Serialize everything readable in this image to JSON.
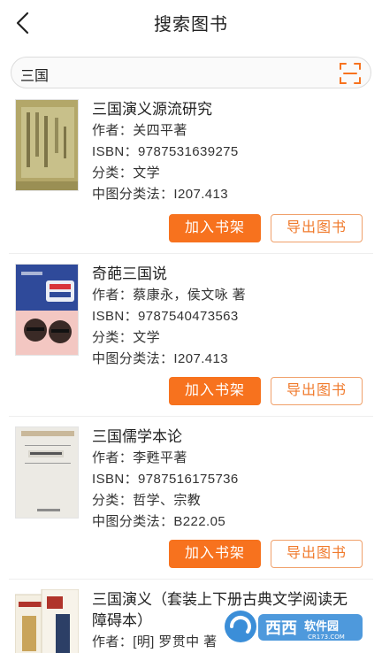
{
  "header": {
    "title": "搜索图书",
    "back_icon": "back-arrow-icon"
  },
  "search": {
    "value": "三国",
    "scan_icon": "scan-icon"
  },
  "labels": {
    "author": "作者：",
    "isbn": "ISBN：",
    "category": "分类：",
    "clc": "中图分类法："
  },
  "buttons": {
    "add": "加入书架",
    "export": "导出图书"
  },
  "books": [
    {
      "title": "三国演义源流研究",
      "author": "关四平著",
      "isbn": "9787531639275",
      "category": "文学",
      "clc": "I207.413"
    },
    {
      "title": "奇葩三国说",
      "author": "蔡康永，侯文咏 著",
      "isbn": "9787540473563",
      "category": "文学",
      "clc": "I207.413"
    },
    {
      "title": "三国儒学本论",
      "author": "李甦平著",
      "isbn": "9787516175736",
      "category": "哲学、宗教",
      "clc": "B222.05"
    },
    {
      "title": "三国演义（套装上下册古典文学阅读无障碍本）",
      "author": "[明] 罗贯中 著"
    }
  ],
  "watermark": {
    "text": "西西",
    "brand": "软件园",
    "url": "CR173.COM"
  },
  "colors": {
    "accent": "#f7721e",
    "accent_border": "#f0a06a"
  }
}
